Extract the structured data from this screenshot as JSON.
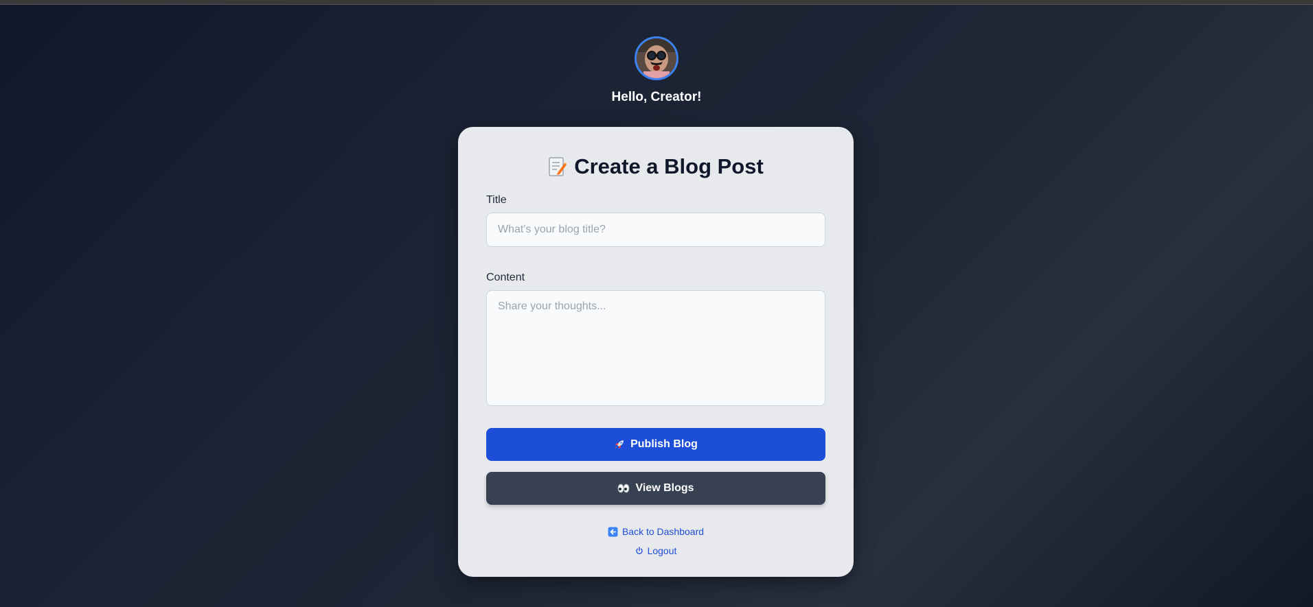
{
  "header": {
    "greeting": "Hello, Creator!"
  },
  "card": {
    "title": "Create a Blog Post",
    "title_icon": "memo-icon",
    "title_field": {
      "label": "Title",
      "placeholder": "What's your blog title?",
      "value": ""
    },
    "content_field": {
      "label": "Content",
      "placeholder": "Share your thoughts...",
      "value": ""
    },
    "publish_button": {
      "label": "Publish Blog",
      "icon": "rocket-icon",
      "color": "#1d4ed8"
    },
    "view_button": {
      "label": "View Blogs",
      "icon": "eyes-icon",
      "color": "#374151"
    },
    "back_link": {
      "label": "Back to Dashboard",
      "icon": "back-arrow-icon"
    },
    "logout_link": {
      "label": "Logout",
      "icon": "power-icon"
    }
  },
  "colors": {
    "accent": "#1d4ed8",
    "avatar_ring": "#3b82f6",
    "card_bg": "#e8e9ec"
  }
}
